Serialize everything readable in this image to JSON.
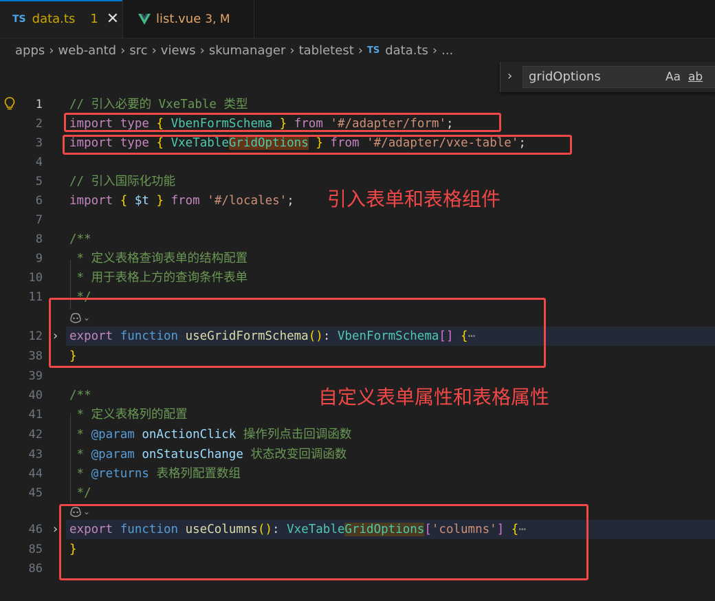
{
  "tabs": [
    {
      "badge": "TS",
      "name": "data.ts",
      "problems": "1",
      "close": "✕"
    },
    {
      "name": "list.vue",
      "status": "3, M"
    }
  ],
  "breadcrumb": [
    "apps",
    "web-antd",
    "src",
    "views",
    "skumanager",
    "tabletest"
  ],
  "breadcrumb_file": {
    "badge": "TS",
    "name": "data.ts",
    "more": "..."
  },
  "find": {
    "value": "gridOptions",
    "match_case": "Aa",
    "whole_word": "ab"
  },
  "line_numbers": {
    "l1": "1",
    "l2": "2",
    "l3": "3",
    "l4": "4",
    "l5": "5",
    "l6": "6",
    "l7": "7",
    "l8": "8",
    "l9": "9",
    "l10": "10",
    "l11": "11",
    "l12": "12",
    "l38": "38",
    "l39": "39",
    "l40": "40",
    "l41": "41",
    "l42": "42",
    "l43": "43",
    "l44": "44",
    "l45": "45",
    "l46": "46",
    "l85": "85",
    "l86": "86"
  },
  "code": {
    "l1_comment": "// 引入必要的 VxeTable 类型",
    "l2": {
      "import": "import",
      "type": "type",
      "name": "VbenFormSchema",
      "from": "from",
      "path": "'#/adapter/form'"
    },
    "l3": {
      "import": "import",
      "type": "type",
      "name_a": "VxeTable",
      "name_b": "GridOptions",
      "from": "from",
      "path": "'#/adapter/vxe-table'"
    },
    "l5_comment": "// 引入国际化功能",
    "l6": {
      "import": "import",
      "name": "$t",
      "from": "from",
      "path": "'#/locales'"
    },
    "l8": "/**",
    "l9": " * 定义表格查询表单的结构配置",
    "l10": " * 用于表格上方的查询条件表单",
    "l11": " */",
    "l12": {
      "export": "export",
      "function": "function",
      "fn": "useGridFormSchema",
      "ret": "VbenFormSchema",
      "ellipsis": "⋯"
    },
    "l38": "}",
    "l40": "/**",
    "l41": " * 定义表格列的配置",
    "l42": {
      "tag": "@param",
      "param": "onActionClick",
      "desc": "操作列点击回调函数"
    },
    "l43": {
      "tag": "@param",
      "param": "onStatusChange",
      "desc": "状态改变回调函数"
    },
    "l44": {
      "tag": "@returns",
      "desc": "表格列配置数组"
    },
    "l45": " */",
    "l46": {
      "export": "export",
      "function": "function",
      "fn": "useColumns",
      "ret_a": "VxeTable",
      "ret_b": "GridOptions",
      "key": "'columns'",
      "ellipsis": "⋯"
    },
    "l85": "}"
  },
  "annotations": {
    "import_note": "引入表单和表格组件",
    "custom_note": "自定义表单属性和表格属性"
  },
  "colors": {
    "annotation": "#f04747",
    "accent": "#0078d4"
  }
}
